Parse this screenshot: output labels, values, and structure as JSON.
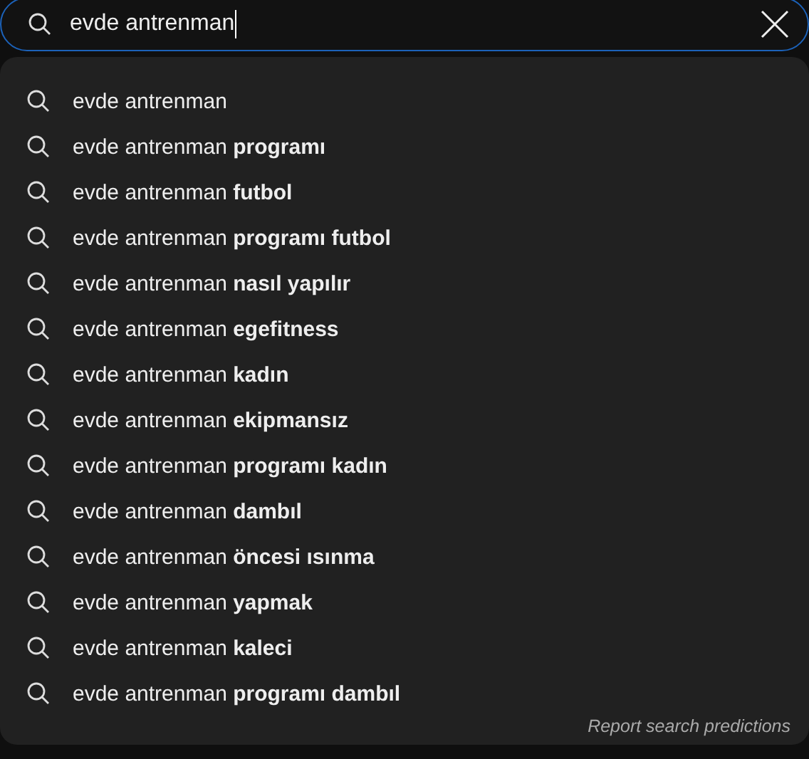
{
  "search": {
    "value": "evde antrenman",
    "focused": true
  },
  "suggestions": [
    {
      "text": "evde antrenman"
    },
    {
      "text": "evde antrenman **programı**"
    },
    {
      "text": "evde antrenman **futbol**"
    },
    {
      "text": "evde antrenman **programı futbol**"
    },
    {
      "text": "evde antrenman **nasıl yapılır**"
    },
    {
      "text": "evde antrenman **egefitness**"
    },
    {
      "text": "evde antrenman **kadın**"
    },
    {
      "text": "evde antrenman **ekipmansız**"
    },
    {
      "text": "evde antrenman **programı kadın**"
    },
    {
      "text": "evde antrenman **dambıl**"
    },
    {
      "text": "evde antrenman **öncesi ısınma**"
    },
    {
      "text": "evde antrenman **yapmak**"
    },
    {
      "text": "evde antrenman **kaleci**"
    },
    {
      "text": "evde antrenman **programı dambıl**"
    }
  ],
  "footer_link": "Report search predictions"
}
